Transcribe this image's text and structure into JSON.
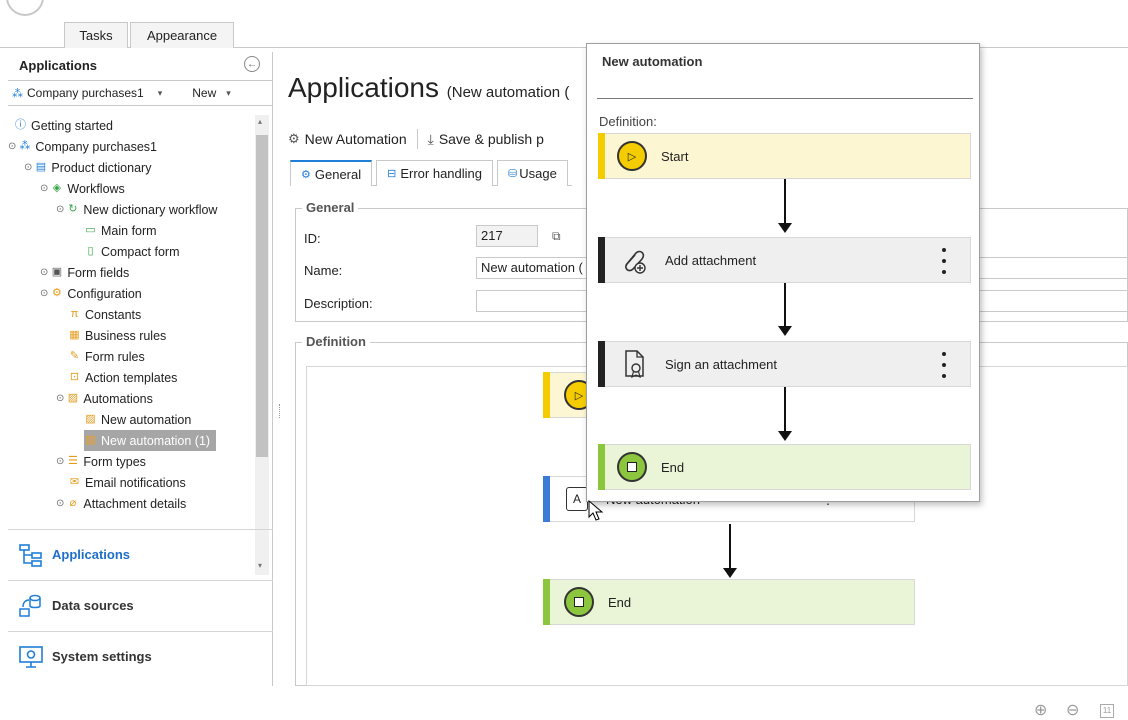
{
  "ribbon": {
    "tabs": [
      "Tasks",
      "Appearance"
    ]
  },
  "sidebar": {
    "title": "Applications",
    "selector": {
      "value": "Company purchases1",
      "new_label": "New"
    },
    "tree": [
      {
        "label": "Getting started",
        "icon": "info-icon"
      },
      {
        "label": "Company purchases1",
        "icon": "app-icon"
      },
      {
        "label": "Product dictionary",
        "icon": "form-icon"
      },
      {
        "label": "Workflows",
        "icon": "layers-icon"
      },
      {
        "label": "New dictionary workflow",
        "icon": "refresh-icon"
      },
      {
        "label": "Main form",
        "icon": "window-icon"
      },
      {
        "label": "Compact form",
        "icon": "mobile-icon"
      },
      {
        "label": "Form fields",
        "icon": "fields-icon"
      },
      {
        "label": "Configuration",
        "icon": "gear-icon"
      },
      {
        "label": "Constants",
        "icon": "pi-icon"
      },
      {
        "label": "Business rules",
        "icon": "rules-icon"
      },
      {
        "label": "Form rules",
        "icon": "edit-icon"
      },
      {
        "label": "Action templates",
        "icon": "template-icon"
      },
      {
        "label": "Automations",
        "icon": "automation-icon"
      },
      {
        "label": "New automation",
        "icon": "automation-icon"
      },
      {
        "label": "New automation (1)",
        "icon": "automation-icon"
      },
      {
        "label": "Form types",
        "icon": "list-icon"
      },
      {
        "label": "Email notifications",
        "icon": "mail-icon"
      },
      {
        "label": "Attachment details",
        "icon": "attachment-icon"
      }
    ],
    "nav": [
      {
        "label": "Applications",
        "icon": "applications-icon"
      },
      {
        "label": "Data sources",
        "icon": "database-icon"
      },
      {
        "label": "System settings",
        "icon": "settings-icon"
      }
    ]
  },
  "main": {
    "title": "Applications",
    "subtitle": "(New automation (",
    "toolbar": {
      "new_automation": "New Automation",
      "save_publish": "Save & publish p"
    },
    "tabs": [
      "General",
      "Error handling",
      "Usage"
    ],
    "general": {
      "legend": "General",
      "id_label": "ID:",
      "id_value": "217",
      "name_label": "Name:",
      "name_value": "New automation (",
      "description_label": "Description:"
    },
    "definition": {
      "legend": "Definition",
      "nodes": [
        "New automation",
        "End"
      ]
    }
  },
  "popup": {
    "title": "New automation",
    "definition_label": "Definition:",
    "nodes": [
      "Start",
      "Add attachment",
      "Sign an attachment",
      "End"
    ]
  },
  "colors": {
    "start": "#f5cc00",
    "end": "#8cc63f",
    "action": "#222222",
    "main_node": "#3a7bd5"
  }
}
